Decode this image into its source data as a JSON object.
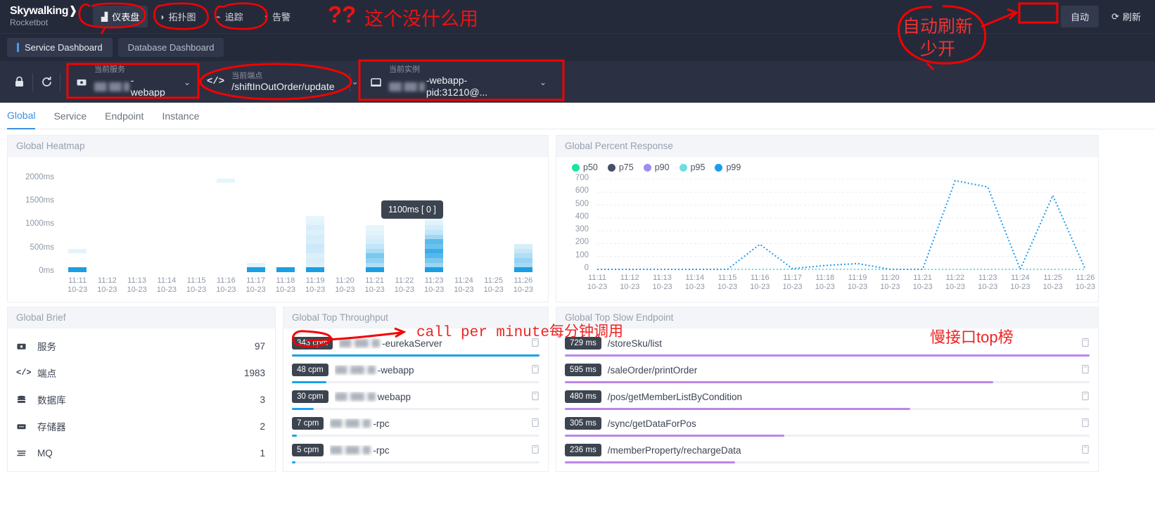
{
  "header": {
    "logo_line1": "Skywalking",
    "logo_line2": "Rocketbot",
    "nav": [
      {
        "label": "仪表盘",
        "icon": "dashboard-icon",
        "active": true
      },
      {
        "label": "拓扑图",
        "icon": "topology-icon",
        "active": false
      },
      {
        "label": "追踪",
        "icon": "trace-icon",
        "active": false
      },
      {
        "label": "告警",
        "icon": "alarm-icon",
        "active": false
      }
    ],
    "auto_button": "自动",
    "refresh_button": "刷新",
    "refresh_icon": "refresh-icon"
  },
  "dashboard_tabs": [
    {
      "label": "Service Dashboard",
      "active": true
    },
    {
      "label": "Database Dashboard",
      "active": false
    }
  ],
  "selectors": {
    "lock_icon": "lock-icon",
    "reload_icon": "reload-icon",
    "service": {
      "icon": "service-icon",
      "label": "当前服务",
      "value": "-webapp",
      "redacted": true,
      "chevron": "chevron-down-icon"
    },
    "endpoint": {
      "icon": "code-icon",
      "label": "当前端点",
      "value": "/shiftInOutOrder/update",
      "redacted": false,
      "chevron": "chevron-down-icon"
    },
    "instance": {
      "icon": "instance-icon",
      "label": "当前实例",
      "value": "-webapp-pid:31210@...",
      "redacted": true,
      "chevron": "chevron-down-icon"
    }
  },
  "subtabs": [
    {
      "label": "Global",
      "active": true
    },
    {
      "label": "Service",
      "active": false
    },
    {
      "label": "Endpoint",
      "active": false
    },
    {
      "label": "Instance",
      "active": false
    }
  ],
  "panels": {
    "heatmap_title": "Global Heatmap",
    "percent_title": "Global Percent Response",
    "brief_title": "Global Brief",
    "throughput_title": "Global Top Throughput",
    "slow_title": "Global Top Slow Endpoint"
  },
  "heatmap_tooltip": "1100ms [ 0 ]",
  "brief": {
    "items": [
      {
        "icon": "service-icon",
        "name": "服务",
        "value": "97"
      },
      {
        "icon": "code-icon",
        "name": "端点",
        "value": "1983"
      },
      {
        "icon": "database-icon",
        "name": "数据库",
        "value": "3"
      },
      {
        "icon": "cache-icon",
        "name": "存储器",
        "value": "2"
      },
      {
        "icon": "mq-icon",
        "name": "MQ",
        "value": "1"
      }
    ]
  },
  "throughput": {
    "copy_icon": "copy-icon",
    "items": [
      {
        "badge": "343 cpm",
        "name": "-eurekaServer",
        "redacted": true,
        "pct": 100
      },
      {
        "badge": "48 cpm",
        "name": "-webapp",
        "redacted": true,
        "pct": 14
      },
      {
        "badge": "30 cpm",
        "name": " webapp",
        "redacted": true,
        "pct": 8.7
      },
      {
        "badge": "7 cpm",
        "name": "-rpc",
        "redacted": true,
        "pct": 2
      },
      {
        "badge": "5 cpm",
        "name": "-rpc",
        "redacted": true,
        "pct": 1.5
      }
    ]
  },
  "slow": {
    "copy_icon": "copy-icon",
    "items": [
      {
        "badge": "729 ms",
        "name": "/storeSku/list",
        "pct": 100
      },
      {
        "badge": "595 ms",
        "name": "/saleOrder/printOrder",
        "pct": 81.6
      },
      {
        "badge": "480 ms",
        "name": "/pos/getMemberListByCondition",
        "pct": 65.8
      },
      {
        "badge": "305 ms",
        "name": "/sync/getDataForPos",
        "pct": 41.8
      },
      {
        "badge": "236 ms",
        "name": "/memberProperty/rechargeData",
        "pct": 32.4
      }
    ]
  },
  "annotations": [
    {
      "id": "anno-useless",
      "text": "这个没什么用"
    },
    {
      "id": "anno-question",
      "text": "??"
    },
    {
      "id": "anno-autorefresh",
      "text": "自动刷新\n少开"
    },
    {
      "id": "anno-cpm",
      "text": "call per minute每分钟调用"
    },
    {
      "id": "anno-slowtop",
      "text": "慢接口top榜"
    }
  ],
  "annotation_texts": {
    "useless": "这个没什么用",
    "question": "??",
    "auto_line1": "自动刷新",
    "auto_line2": "少开",
    "cpm": "call per minute每分钟调用",
    "slowtop": "慢接口top榜"
  },
  "chart_data": [
    {
      "type": "heatmap",
      "title": "Global Heatmap",
      "xlabel": "",
      "ylabel": "",
      "ylim": [
        0,
        2250
      ],
      "yticks": [
        0,
        500,
        1000,
        1500,
        2000
      ],
      "ytick_labels": [
        "0ms",
        "500ms",
        "1000ms",
        "1500ms",
        "2000ms"
      ],
      "x": [
        "11:11",
        "11:12",
        "11:13",
        "11:14",
        "11:15",
        "11:16",
        "11:17",
        "11:18",
        "11:19",
        "11:20",
        "11:21",
        "11:22",
        "11:23",
        "11:24",
        "11:25",
        "11:26"
      ],
      "x_sub": "10-23",
      "tooltip": "1100ms [ 0 ]",
      "columns": [
        {
          "x": "11:11",
          "cells": [
            {
              "lo": 0,
              "hi": 100,
              "v": 0.95
            },
            {
              "lo": 400,
              "hi": 500,
              "v": 0.06
            }
          ]
        },
        {
          "x": "11:12",
          "cells": []
        },
        {
          "x": "11:13",
          "cells": []
        },
        {
          "x": "11:14",
          "cells": []
        },
        {
          "x": "11:15",
          "cells": []
        },
        {
          "x": "11:16",
          "cells": [
            {
              "lo": 1900,
              "hi": 2000,
              "v": 0.05
            }
          ]
        },
        {
          "x": "11:17",
          "cells": [
            {
              "lo": 0,
              "hi": 100,
              "v": 0.95
            },
            {
              "lo": 100,
              "hi": 200,
              "v": 0.07
            }
          ]
        },
        {
          "x": "11:18",
          "cells": [
            {
              "lo": 0,
              "hi": 100,
              "v": 0.95
            }
          ]
        },
        {
          "x": "11:19",
          "cells": [
            {
              "lo": 0,
              "hi": 100,
              "v": 0.95
            },
            {
              "lo": 100,
              "hi": 200,
              "v": 0.1
            },
            {
              "lo": 200,
              "hi": 300,
              "v": 0.12
            },
            {
              "lo": 300,
              "hi": 400,
              "v": 0.1
            },
            {
              "lo": 400,
              "hi": 500,
              "v": 0.16
            },
            {
              "lo": 500,
              "hi": 600,
              "v": 0.18
            },
            {
              "lo": 600,
              "hi": 700,
              "v": 0.12
            },
            {
              "lo": 700,
              "hi": 800,
              "v": 0.14
            },
            {
              "lo": 800,
              "hi": 900,
              "v": 0.09
            },
            {
              "lo": 900,
              "hi": 1000,
              "v": 0.12
            },
            {
              "lo": 1000,
              "hi": 1100,
              "v": 0.07
            },
            {
              "lo": 1100,
              "hi": 1200,
              "v": 0.05
            }
          ]
        },
        {
          "x": "11:20",
          "cells": []
        },
        {
          "x": "11:21",
          "cells": [
            {
              "lo": 0,
              "hi": 100,
              "v": 0.95
            },
            {
              "lo": 100,
              "hi": 200,
              "v": 0.3
            },
            {
              "lo": 200,
              "hi": 300,
              "v": 0.45
            },
            {
              "lo": 300,
              "hi": 400,
              "v": 0.55
            },
            {
              "lo": 400,
              "hi": 500,
              "v": 0.32
            },
            {
              "lo": 500,
              "hi": 600,
              "v": 0.22
            },
            {
              "lo": 600,
              "hi": 700,
              "v": 0.14
            },
            {
              "lo": 700,
              "hi": 800,
              "v": 0.1
            },
            {
              "lo": 800,
              "hi": 900,
              "v": 0.07
            },
            {
              "lo": 900,
              "hi": 1000,
              "v": 0.05
            }
          ]
        },
        {
          "x": "11:22",
          "cells": []
        },
        {
          "x": "11:23",
          "cells": [
            {
              "lo": 0,
              "hi": 100,
              "v": 0.95
            },
            {
              "lo": 100,
              "hi": 200,
              "v": 0.4
            },
            {
              "lo": 200,
              "hi": 300,
              "v": 0.55
            },
            {
              "lo": 300,
              "hi": 400,
              "v": 0.72
            },
            {
              "lo": 400,
              "hi": 500,
              "v": 0.85
            },
            {
              "lo": 500,
              "hi": 600,
              "v": 0.62
            },
            {
              "lo": 600,
              "hi": 700,
              "v": 0.7
            },
            {
              "lo": 700,
              "hi": 800,
              "v": 0.38
            },
            {
              "lo": 800,
              "hi": 900,
              "v": 0.22
            },
            {
              "lo": 900,
              "hi": 1000,
              "v": 0.14
            },
            {
              "lo": 1000,
              "hi": 1100,
              "v": 0.08
            },
            {
              "lo": 1100,
              "hi": 1200,
              "v": 0.05
            }
          ]
        },
        {
          "x": "11:24",
          "cells": []
        },
        {
          "x": "11:25",
          "cells": []
        },
        {
          "x": "11:26",
          "cells": [
            {
              "lo": 0,
              "hi": 100,
              "v": 0.95
            },
            {
              "lo": 100,
              "hi": 200,
              "v": 0.35
            },
            {
              "lo": 200,
              "hi": 300,
              "v": 0.42
            },
            {
              "lo": 300,
              "hi": 400,
              "v": 0.3
            },
            {
              "lo": 400,
              "hi": 500,
              "v": 0.2
            },
            {
              "lo": 500,
              "hi": 600,
              "v": 0.12
            }
          ]
        }
      ]
    },
    {
      "type": "line",
      "title": "Global Percent Response",
      "xlabel": "",
      "ylabel": "",
      "ylim": [
        0,
        700
      ],
      "yticks": [
        0,
        100,
        200,
        300,
        400,
        500,
        600,
        700
      ],
      "x": [
        "11:11",
        "11:12",
        "11:13",
        "11:14",
        "11:15",
        "11:16",
        "11:17",
        "11:18",
        "11:19",
        "11:20",
        "11:21",
        "11:22",
        "11:23",
        "11:24",
        "11:25",
        "11:26"
      ],
      "x_sub": "10-23",
      "legend": [
        {
          "name": "p50",
          "color": "#17e5a0"
        },
        {
          "name": "p75",
          "color": "#474f68"
        },
        {
          "name": "p90",
          "color": "#9f8df0"
        },
        {
          "name": "p95",
          "color": "#6fdde0"
        },
        {
          "name": "p99",
          "color": "#1e9cf0"
        }
      ],
      "legend_position": "top-left",
      "grid": true,
      "series": [
        {
          "name": "p50",
          "color": "#17e5a0",
          "values": [
            0,
            0,
            0,
            0,
            0,
            0,
            0,
            0,
            0,
            0,
            0,
            0,
            0,
            0,
            0,
            0
          ]
        },
        {
          "name": "p75",
          "color": "#474f68",
          "values": [
            0,
            0,
            0,
            0,
            0,
            0,
            0,
            0,
            0,
            0,
            0,
            0,
            0,
            0,
            0,
            0
          ]
        },
        {
          "name": "p90",
          "color": "#9f8df0",
          "values": [
            0,
            0,
            0,
            0,
            0,
            0,
            0,
            0,
            0,
            0,
            0,
            0,
            0,
            0,
            0,
            0
          ]
        },
        {
          "name": "p95",
          "color": "#6fdde0",
          "values": [
            0,
            0,
            0,
            0,
            0,
            0,
            0,
            0,
            0,
            0,
            0,
            0,
            0,
            0,
            0,
            0
          ]
        },
        {
          "name": "p99",
          "color": "#1e9cf0",
          "values": [
            0,
            0,
            0,
            0,
            0,
            195,
            5,
            30,
            45,
            0,
            0,
            690,
            640,
            0,
            575,
            0
          ]
        }
      ]
    }
  ]
}
